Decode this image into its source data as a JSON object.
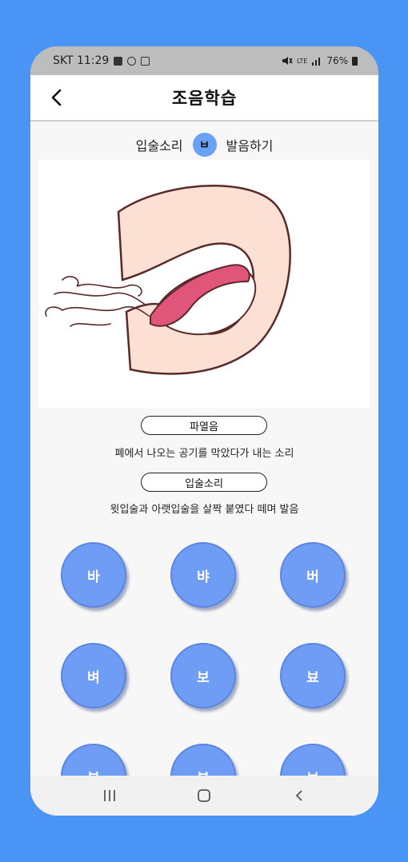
{
  "status_bar": {
    "carrier_time": "SKT 11:29",
    "battery": "76%",
    "network": "LTE",
    "icons": [
      "gallery-icon",
      "alarm-icon",
      "app-notification-icon",
      "mute-icon",
      "signal-icon",
      "battery-icon"
    ]
  },
  "header": {
    "title": "조음학습",
    "back_icon": "chevron-left-icon"
  },
  "subtitle": {
    "prefix": "입술소리",
    "letter": "ㅂ",
    "suffix": "발음하기"
  },
  "illustration": {
    "description_icon": "mouth-pronunciation-illustration"
  },
  "info": {
    "tag1": "파열음",
    "desc1": "폐에서 나오는 공기를 막았다가 내는 소리",
    "tag2": "입술소리",
    "desc2": "윗입술과 아랫입술을 살짝 붙였다 떼며 발음"
  },
  "syllables": [
    "바",
    "뱌",
    "버",
    "벼",
    "보",
    "뵤",
    "부",
    "뷰",
    "브"
  ],
  "nav": {
    "recents_icon": "recent-apps-icon",
    "home_icon": "home-icon",
    "back_icon": "back-icon"
  },
  "colors": {
    "background": "#4a94f6",
    "button": "#6f9cf5",
    "tongue": "#e0557a",
    "lips": "#fde0d4"
  }
}
